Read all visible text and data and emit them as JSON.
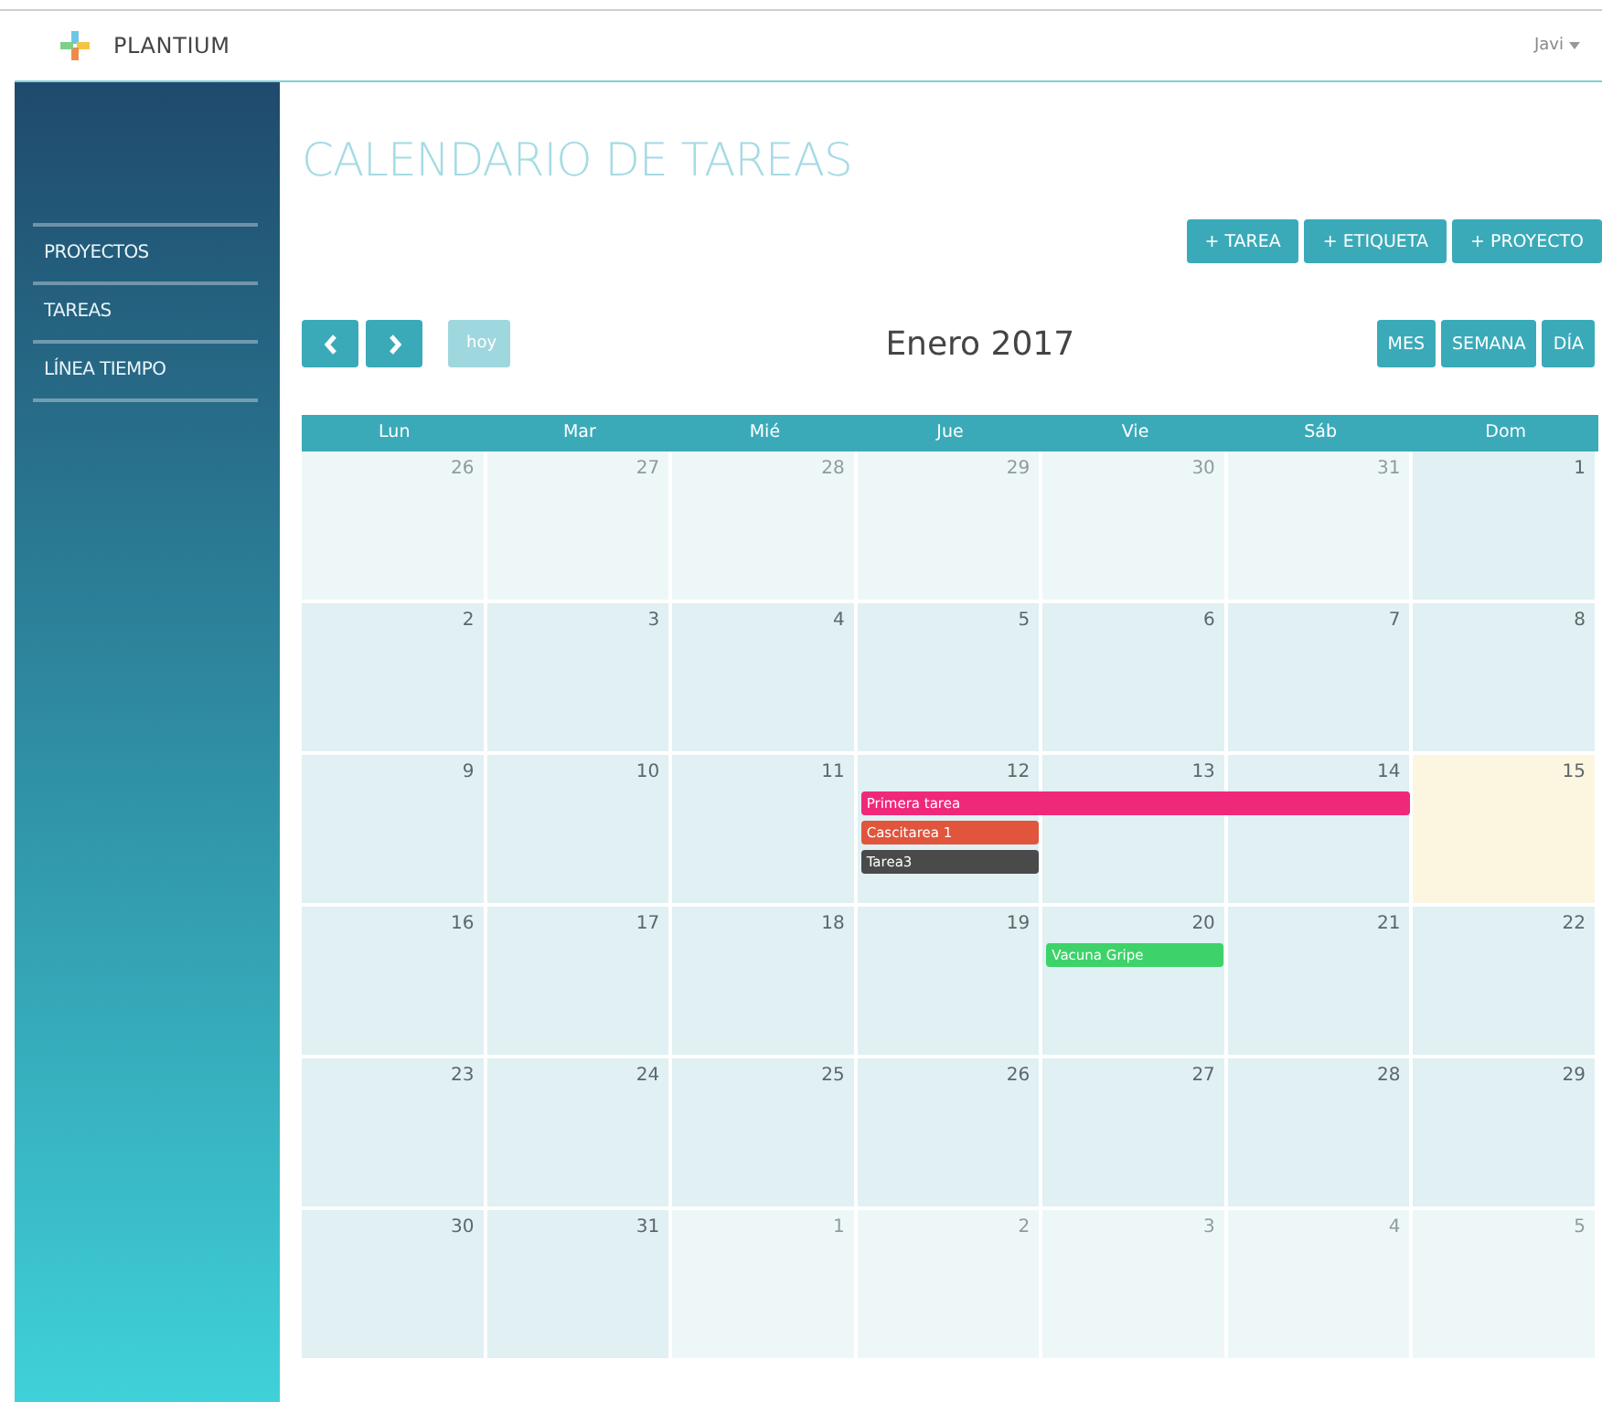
{
  "header": {
    "brand": "PLANTIUM",
    "user": "Javi"
  },
  "sidebar": {
    "items": [
      {
        "label": "PROYECTOS"
      },
      {
        "label": "TAREAS"
      },
      {
        "label": "LÍNEA TIEMPO"
      }
    ]
  },
  "page_title": "CALENDARIO DE TAREAS",
  "actions": [
    "+ TAREA",
    "+ ETIQUETA",
    "+ PROYECTO"
  ],
  "toolbar": {
    "today": {
      "label": "hoy",
      "disabled": true
    },
    "month_label": "Enero 2017",
    "views": [
      "MES",
      "SEMANA",
      "DÍA"
    ]
  },
  "calendar": {
    "weekdays": [
      "Lun",
      "Mar",
      "Mié",
      "Jue",
      "Vie",
      "Sáb",
      "Dom"
    ],
    "weeks": [
      {
        "days": [
          {
            "label": "26",
            "kind": "other"
          },
          {
            "label": "27",
            "kind": "other"
          },
          {
            "label": "28",
            "kind": "other"
          },
          {
            "label": "29",
            "kind": "other"
          },
          {
            "label": "30",
            "kind": "other"
          },
          {
            "label": "31",
            "kind": "other"
          },
          {
            "label": "1",
            "kind": "current"
          }
        ]
      },
      {
        "days": [
          {
            "label": "2",
            "kind": "current"
          },
          {
            "label": "3",
            "kind": "current"
          },
          {
            "label": "4",
            "kind": "current"
          },
          {
            "label": "5",
            "kind": "current"
          },
          {
            "label": "6",
            "kind": "current"
          },
          {
            "label": "7",
            "kind": "current"
          },
          {
            "label": "8",
            "kind": "current"
          }
        ]
      },
      {
        "days": [
          {
            "label": "9",
            "kind": "current"
          },
          {
            "label": "10",
            "kind": "current"
          },
          {
            "label": "11",
            "kind": "current"
          },
          {
            "label": "12",
            "kind": "current",
            "events": [
              {
                "title": "Primera tarea",
                "color": "#f0287a",
                "continued": false
              },
              {
                "title": "Cascitarea 1",
                "color": "#e0553c",
                "continued": false
              },
              {
                "title": "Tarea3",
                "color": "#4a4a4a",
                "continued": false
              }
            ]
          },
          {
            "label": "13",
            "kind": "current",
            "events": [
              {
                "continued": true
              }
            ]
          },
          {
            "label": "14",
            "kind": "current",
            "events": [
              {
                "continued": true
              }
            ]
          },
          {
            "label": "15",
            "kind": "today"
          }
        ]
      },
      {
        "days": [
          {
            "label": "16",
            "kind": "current"
          },
          {
            "label": "17",
            "kind": "current"
          },
          {
            "label": "18",
            "kind": "current"
          },
          {
            "label": "19",
            "kind": "current"
          },
          {
            "label": "20",
            "kind": "current",
            "events": [
              {
                "title": "Vacuna Gripe",
                "color": "#3ed26a",
                "continued": false
              }
            ]
          },
          {
            "label": "21",
            "kind": "current"
          },
          {
            "label": "22",
            "kind": "current"
          }
        ]
      },
      {
        "days": [
          {
            "label": "23",
            "kind": "current"
          },
          {
            "label": "24",
            "kind": "current"
          },
          {
            "label": "25",
            "kind": "current"
          },
          {
            "label": "26",
            "kind": "current"
          },
          {
            "label": "27",
            "kind": "current"
          },
          {
            "label": "28",
            "kind": "current"
          },
          {
            "label": "29",
            "kind": "current"
          }
        ]
      },
      {
        "days": [
          {
            "label": "30",
            "kind": "current"
          },
          {
            "label": "31",
            "kind": "current"
          },
          {
            "label": "1",
            "kind": "other"
          },
          {
            "label": "2",
            "kind": "other"
          },
          {
            "label": "3",
            "kind": "other"
          },
          {
            "label": "4",
            "kind": "other"
          },
          {
            "label": "5",
            "kind": "other"
          }
        ]
      }
    ]
  }
}
